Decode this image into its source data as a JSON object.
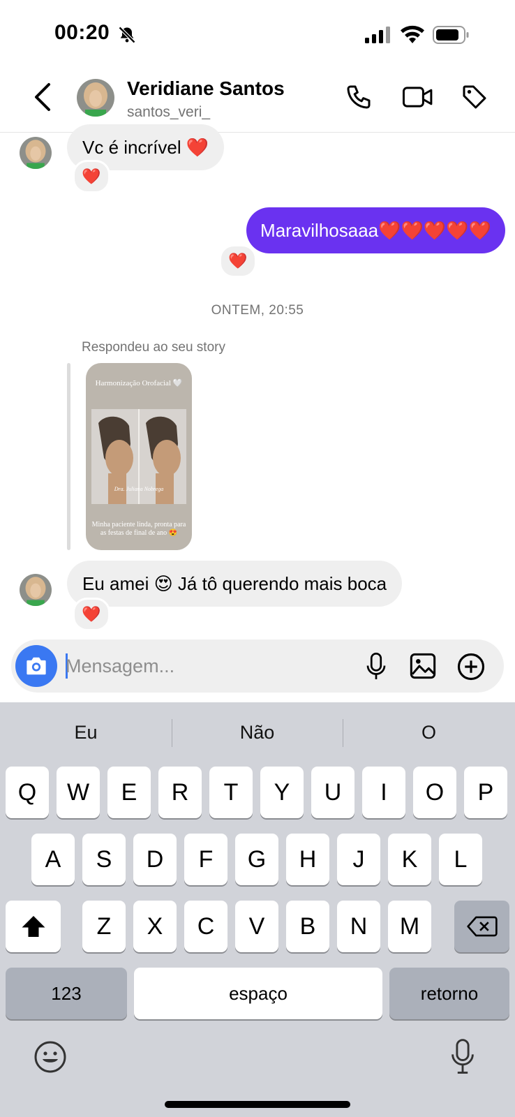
{
  "status_bar": {
    "time": "00:20"
  },
  "header": {
    "name": "Veridiane Santos",
    "username": "santos_veri_"
  },
  "messages": {
    "m1": {
      "text": "Vc é incrível ❤️",
      "reaction": "❤️"
    },
    "m2": {
      "text": "Maravilhosaaa❤️❤️❤️❤️❤️",
      "reaction": "❤️"
    },
    "timestamp": "ONTEM, 20:55",
    "story_reply_label": "Respondeu ao seu story",
    "story": {
      "title": "Harmonização Orofacial 🤍",
      "signature": "Dra. Juliana Nobrega",
      "caption": "Minha paciente linda, pronta para as festas de final de ano 😍"
    },
    "m3": {
      "text": "Eu amei 😍 Já tô querendo mais boca",
      "reaction": "❤️"
    }
  },
  "composer": {
    "placeholder": "Mensagem..."
  },
  "keyboard": {
    "suggestions": [
      "Eu",
      "Não",
      "O"
    ],
    "row1": [
      "Q",
      "W",
      "E",
      "R",
      "T",
      "Y",
      "U",
      "I",
      "O",
      "P"
    ],
    "row2": [
      "A",
      "S",
      "D",
      "F",
      "G",
      "H",
      "J",
      "K",
      "L"
    ],
    "row3": [
      "Z",
      "X",
      "C",
      "V",
      "B",
      "N",
      "M"
    ],
    "numbers": "123",
    "space": "espaço",
    "return": "retorno"
  },
  "colors": {
    "accent": "#6a32f0",
    "camera": "#3a78f2",
    "keyboard_bg": "#d1d3d9"
  }
}
